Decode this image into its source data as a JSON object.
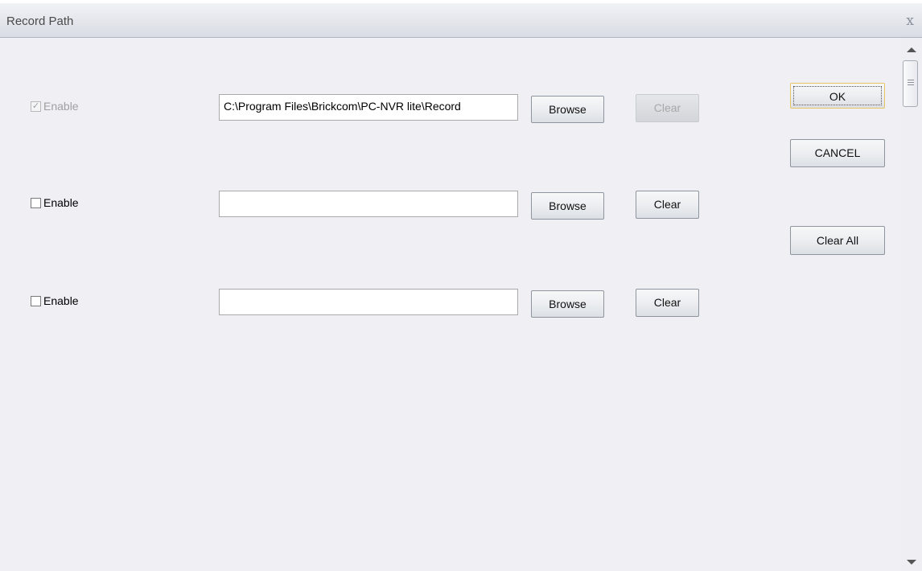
{
  "window": {
    "title": "Record Path",
    "close_glyph": "x"
  },
  "rows": [
    {
      "enable_label": "Enable",
      "enabled_checked": true,
      "disabled": true,
      "check_glyph": "✓",
      "path": "C:\\Program Files\\Brickcom\\PC-NVR lite\\Record",
      "browse_label": "Browse",
      "clear_label": "Clear",
      "clear_disabled": true
    },
    {
      "enable_label": "Enable",
      "enabled_checked": false,
      "disabled": false,
      "check_glyph": "",
      "path": "",
      "browse_label": "Browse",
      "clear_label": "Clear",
      "clear_disabled": false
    },
    {
      "enable_label": "Enable",
      "enabled_checked": false,
      "disabled": false,
      "check_glyph": "",
      "path": "",
      "browse_label": "Browse",
      "clear_label": "Clear",
      "clear_disabled": false
    }
  ],
  "actions": {
    "ok_label": "OK",
    "cancel_label": "CANCEL",
    "clear_all_label": "Clear All"
  },
  "colors": {
    "accent_focus": "#e6c566",
    "background": "#efeff4"
  }
}
